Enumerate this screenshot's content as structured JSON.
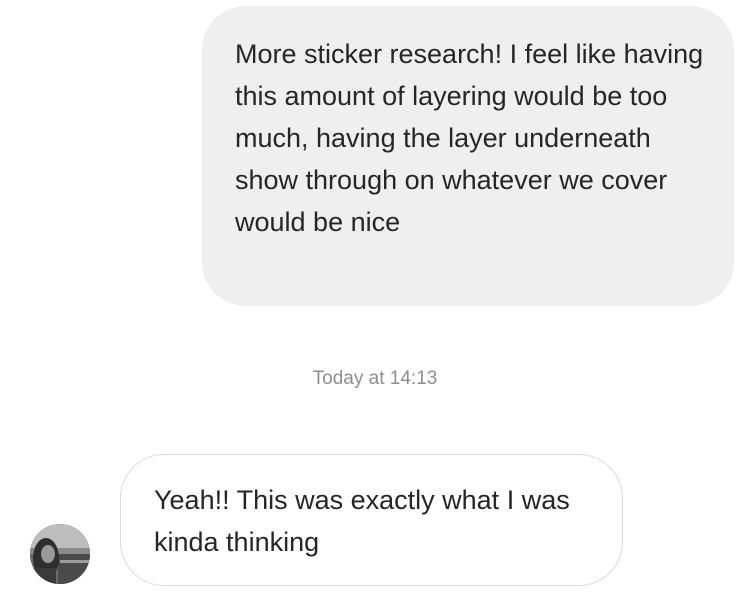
{
  "thread": {
    "sent_message": {
      "text": "More sticker research! I feel like having this amount of layering would be too much, having the layer underneath show through on whatever we cover would be nice"
    },
    "timestamp": "Today at 14:13",
    "received_message": {
      "text": "Yeah!! This was exactly what I was kinda thinking"
    },
    "avatar": {
      "icon": "profile-photo-avatar"
    }
  }
}
